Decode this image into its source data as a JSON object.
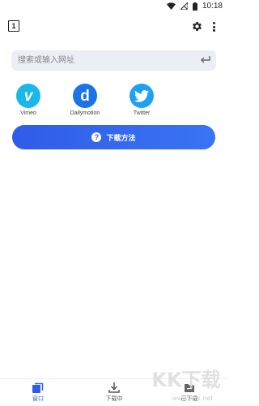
{
  "status_bar": {
    "time": "10:18"
  },
  "toolbar": {
    "tab_count": "1"
  },
  "search": {
    "placeholder": "搜索或输入网址"
  },
  "quick_sites": [
    {
      "name": "Vimeo",
      "color": "#1ab7ea",
      "icon": "vimeo-logo"
    },
    {
      "name": "Dailymotion",
      "color": "#1a73e8",
      "icon": "dailymotion-logo"
    },
    {
      "name": "Twitter",
      "color": "#1da1f2",
      "icon": "twitter-logo"
    }
  ],
  "download_method": {
    "label": "下载方法",
    "icon": "question-icon"
  },
  "bottom_nav": [
    {
      "label": "窗口",
      "icon": "windows-icon",
      "active": true
    },
    {
      "label": "下载中",
      "icon": "download-icon",
      "active": false
    },
    {
      "label": "已下载",
      "icon": "folder-icon",
      "active": false
    }
  ],
  "watermark": {
    "text": "KK下载",
    "domain": "www.kkx.net"
  },
  "colors": {
    "accent": "#2f5ce8",
    "search_bg": "#eceef5"
  }
}
